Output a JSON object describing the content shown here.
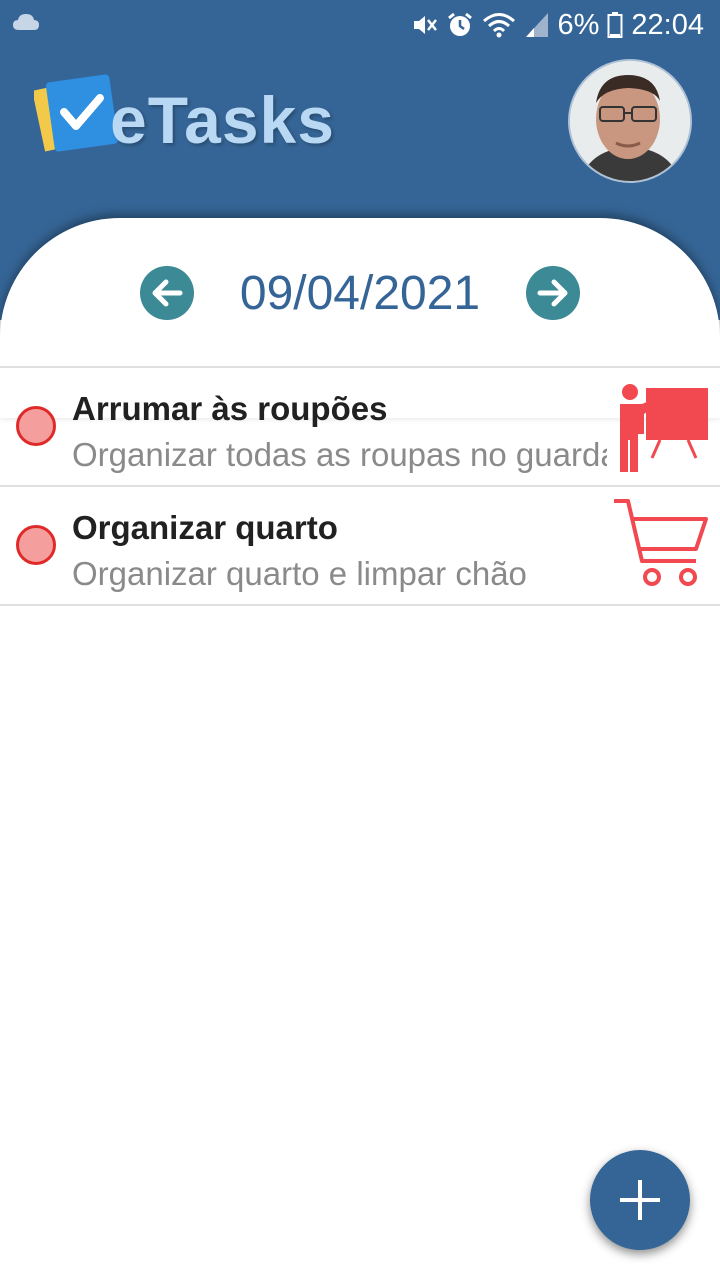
{
  "status_bar": {
    "battery": "6%",
    "time": "22:04",
    "icons": [
      "cloud-icon",
      "mute-icon",
      "alarm-icon",
      "wifi-icon",
      "signal-icon",
      "battery-icon"
    ]
  },
  "header": {
    "app_name": "eTasks",
    "logo_icon": "checkbox-notes-icon",
    "avatar": "user-avatar"
  },
  "date_nav": {
    "date": "09/04/2021",
    "prev_icon": "arrow-left-icon",
    "next_icon": "arrow-right-icon"
  },
  "tasks": [
    {
      "title": "Arrumar às roupões",
      "description": "Organizar todas as roupas no guarda-roupa",
      "status_color": "#f59e9e",
      "category_icon": "presentation-board-icon"
    },
    {
      "title": "Organizar quarto",
      "description": "Organizar quarto e limpar chão",
      "status_color": "#f59e9e",
      "category_icon": "shopping-cart-icon"
    }
  ],
  "fab": {
    "icon": "plus-icon"
  },
  "colors": {
    "primary": "#356596",
    "accent_teal": "#3c8a95",
    "category_red": "#f2484f",
    "status_border": "#e02a2a"
  }
}
